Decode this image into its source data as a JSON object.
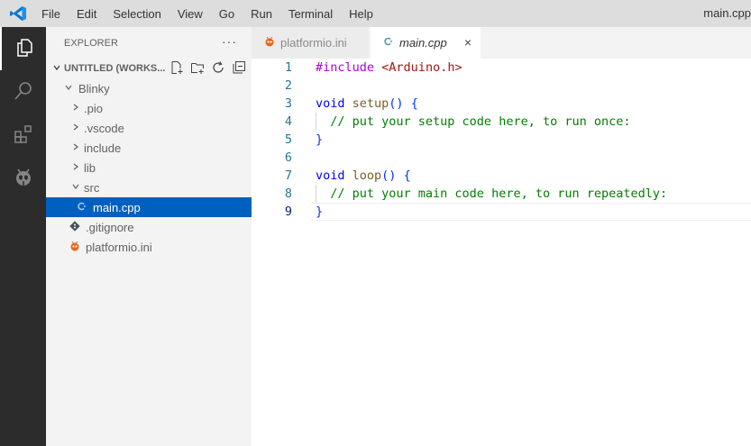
{
  "menu": [
    "File",
    "Edit",
    "Selection",
    "View",
    "Go",
    "Run",
    "Terminal",
    "Help"
  ],
  "window_title": "main.cpp",
  "activity": [
    "explorer-icon",
    "search-icon",
    "extensions-icon",
    "platformio-icon"
  ],
  "sidebar": {
    "title": "EXPLORER",
    "more": "···",
    "workspace": "UNTITLED (WORKS...",
    "tree": [
      {
        "label": "Blinky",
        "kind": "folder-open",
        "depth": 1
      },
      {
        "label": ".pio",
        "kind": "folder",
        "depth": 2
      },
      {
        "label": ".vscode",
        "kind": "folder",
        "depth": 2
      },
      {
        "label": "include",
        "kind": "folder",
        "depth": 2
      },
      {
        "label": "lib",
        "kind": "folder",
        "depth": 2
      },
      {
        "label": "src",
        "kind": "folder-open",
        "depth": 2
      },
      {
        "label": "main.cpp",
        "kind": "cpp",
        "depth": 3,
        "selected": true
      },
      {
        "label": ".gitignore",
        "kind": "git",
        "depth": 2
      },
      {
        "label": "platformio.ini",
        "kind": "pio",
        "depth": 2
      }
    ]
  },
  "tabs": [
    {
      "label": "platformio.ini",
      "active": false
    },
    {
      "label": "main.cpp",
      "active": true,
      "close": "×"
    }
  ],
  "editor": {
    "current_line": 9,
    "lines": [
      {
        "num": "1",
        "code": "#include <Arduino.h>"
      },
      {
        "num": "2",
        "code": ""
      },
      {
        "num": "3",
        "code": "void setup() {"
      },
      {
        "num": "4",
        "code": "  // put your setup code here, to run once:"
      },
      {
        "num": "5",
        "code": "}"
      },
      {
        "num": "6",
        "code": ""
      },
      {
        "num": "7",
        "code": "void loop() {"
      },
      {
        "num": "8",
        "code": "  // put your main code here, to run repeatedly:"
      },
      {
        "num": "9",
        "code": "}"
      }
    ]
  },
  "colors": {
    "activity_bg": "#2c2c2c",
    "sidebar_bg": "#f3f3f3",
    "selection": "#0060c0",
    "keyword": "#0000ff",
    "comment": "#008000",
    "preprocessor": "#af00db",
    "string": "#a31515",
    "line_number": "#237893"
  }
}
